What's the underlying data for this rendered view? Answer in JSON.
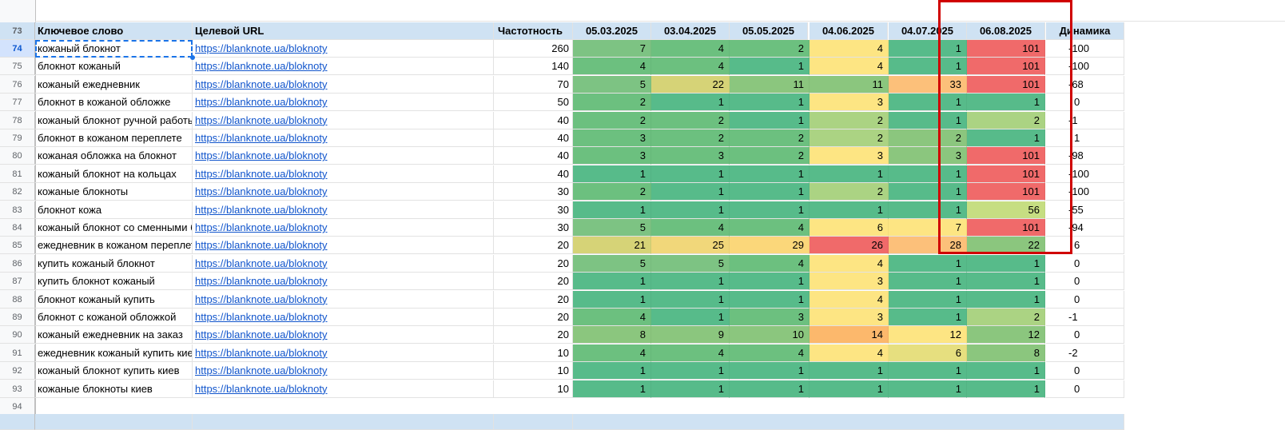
{
  "header": {
    "row_number": "73",
    "keyword": "Ключевое слово",
    "url": "Целевой URL",
    "freq": "Частотность",
    "dates": [
      "05.03.2025",
      "03.04.2025",
      "05.05.2025",
      "04.06.2025",
      "04.07.2025",
      "06.08.2025"
    ],
    "dynamics": "Динамика"
  },
  "rows": [
    {
      "n": "74",
      "kw": "кожаный блокнот",
      "url": "https://blanknote.ua/bloknoty",
      "freq": "260",
      "pos": [
        "7",
        "4",
        "2",
        "4",
        "1",
        "101"
      ],
      "dyn": "-100"
    },
    {
      "n": "75",
      "kw": "блокнот кожаный",
      "url": "https://blanknote.ua/bloknoty",
      "freq": "140",
      "pos": [
        "4",
        "4",
        "1",
        "4",
        "1",
        "101"
      ],
      "dyn": "-100"
    },
    {
      "n": "76",
      "kw": "кожаный ежедневник",
      "url": "https://blanknote.ua/bloknoty",
      "freq": "70",
      "pos": [
        "5",
        "22",
        "11",
        "11",
        "33",
        "101"
      ],
      "dyn": "-68"
    },
    {
      "n": "77",
      "kw": "блокнот в кожаной обложке",
      "url": "https://blanknote.ua/bloknoty",
      "freq": "50",
      "pos": [
        "2",
        "1",
        "1",
        "3",
        "1",
        "1"
      ],
      "dyn": "0"
    },
    {
      "n": "78",
      "kw": "кожаный блокнот ручной работы",
      "url": "https://blanknote.ua/bloknoty",
      "freq": "40",
      "pos": [
        "2",
        "2",
        "1",
        "2",
        "1",
        "2"
      ],
      "dyn": "-1"
    },
    {
      "n": "79",
      "kw": "блокнот в кожаном переплете",
      "url": "https://blanknote.ua/bloknoty",
      "freq": "40",
      "pos": [
        "3",
        "2",
        "2",
        "2",
        "2",
        "1"
      ],
      "dyn": "1"
    },
    {
      "n": "80",
      "kw": "кожаная обложка на блокнот",
      "url": "https://blanknote.ua/bloknoty",
      "freq": "40",
      "pos": [
        "3",
        "3",
        "2",
        "3",
        "3",
        "101"
      ],
      "dyn": "-98"
    },
    {
      "n": "81",
      "kw": "кожаный блокнот на кольцах",
      "url": "https://blanknote.ua/bloknoty",
      "freq": "40",
      "pos": [
        "1",
        "1",
        "1",
        "1",
        "1",
        "101"
      ],
      "dyn": "-100"
    },
    {
      "n": "82",
      "kw": "кожаные блокноты",
      "url": "https://blanknote.ua/bloknoty",
      "freq": "30",
      "pos": [
        "2",
        "1",
        "1",
        "2",
        "1",
        "101"
      ],
      "dyn": "-100"
    },
    {
      "n": "83",
      "kw": "блокнот кожа",
      "url": "https://blanknote.ua/bloknoty",
      "freq": "30",
      "pos": [
        "1",
        "1",
        "1",
        "1",
        "1",
        "56"
      ],
      "dyn": "-55"
    },
    {
      "n": "84",
      "kw": "кожаный блокнот со сменными блоками",
      "url": "https://blanknote.ua/bloknoty",
      "freq": "30",
      "pos": [
        "5",
        "4",
        "4",
        "6",
        "7",
        "101"
      ],
      "dyn": "-94"
    },
    {
      "n": "85",
      "kw": "ежедневник в кожаном переплете",
      "url": "https://blanknote.ua/bloknoty",
      "freq": "20",
      "pos": [
        "21",
        "25",
        "29",
        "26",
        "28",
        "22"
      ],
      "dyn": "6"
    },
    {
      "n": "86",
      "kw": "купить кожаный блокнот",
      "url": "https://blanknote.ua/bloknoty",
      "freq": "20",
      "pos": [
        "5",
        "5",
        "4",
        "4",
        "1",
        "1"
      ],
      "dyn": "0"
    },
    {
      "n": "87",
      "kw": "купить блокнот кожаный",
      "url": "https://blanknote.ua/bloknoty",
      "freq": "20",
      "pos": [
        "1",
        "1",
        "1",
        "3",
        "1",
        "1"
      ],
      "dyn": "0"
    },
    {
      "n": "88",
      "kw": "блокнот кожаный купить",
      "url": "https://blanknote.ua/bloknoty",
      "freq": "20",
      "pos": [
        "1",
        "1",
        "1",
        "4",
        "1",
        "1"
      ],
      "dyn": "0"
    },
    {
      "n": "89",
      "kw": "блокнот с кожаной обложкой",
      "url": "https://blanknote.ua/bloknoty",
      "freq": "20",
      "pos": [
        "4",
        "1",
        "3",
        "3",
        "1",
        "2"
      ],
      "dyn": "-1"
    },
    {
      "n": "90",
      "kw": "кожаный ежедневник на заказ",
      "url": "https://blanknote.ua/bloknoty",
      "freq": "20",
      "pos": [
        "8",
        "9",
        "10",
        "14",
        "12",
        "12"
      ],
      "dyn": "0"
    },
    {
      "n": "91",
      "kw": "ежедневник кожаный купить киев",
      "url": "https://blanknote.ua/bloknoty",
      "freq": "10",
      "pos": [
        "4",
        "4",
        "4",
        "4",
        "6",
        "8"
      ],
      "dyn": "-2"
    },
    {
      "n": "92",
      "kw": "кожаный блокнот купить киев",
      "url": "https://blanknote.ua/bloknoty",
      "freq": "10",
      "pos": [
        "1",
        "1",
        "1",
        "1",
        "1",
        "1"
      ],
      "dyn": "0"
    },
    {
      "n": "93",
      "kw": "кожаные блокноты киев",
      "url": "https://blanknote.ua/bloknoty",
      "freq": "10",
      "pos": [
        "1",
        "1",
        "1",
        "1",
        "1",
        "1"
      ],
      "dyn": "0"
    }
  ],
  "empty_row": "94",
  "colors": {
    "green_dark": "#57bb8a",
    "green_mid": "#6cc07f",
    "green_light": "#abd383",
    "yellow_green": "#d6d377",
    "yellow": "#fde583",
    "orange": "#fcb86c",
    "red": "#f06a6a",
    "header_bg": "#cfe2f3",
    "highlight_border": "#d00000"
  }
}
